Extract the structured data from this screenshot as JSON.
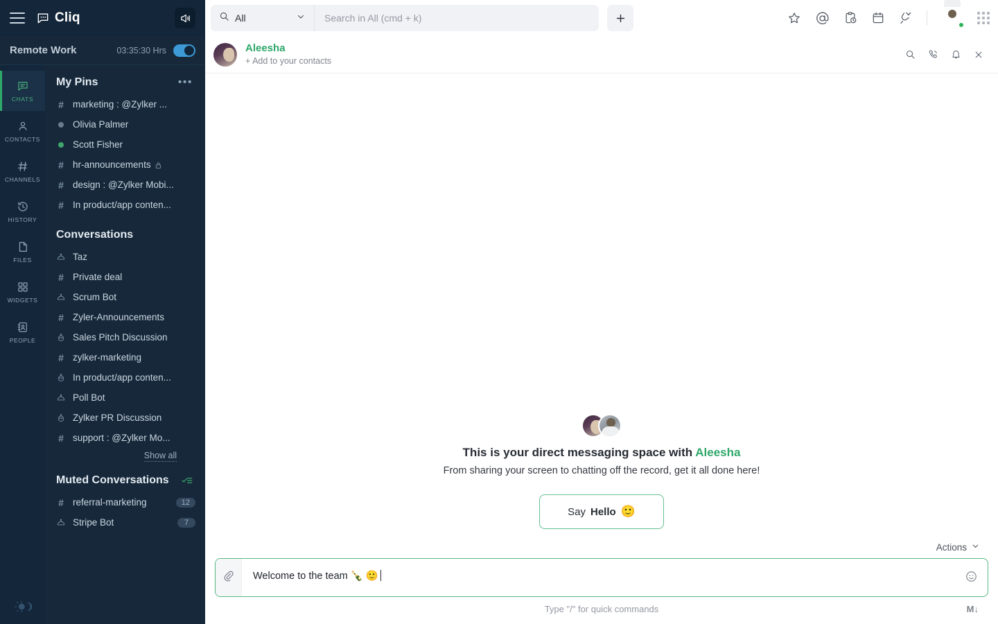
{
  "brand": {
    "name": "Cliq",
    "logo_icon": "chat-bubble-logo",
    "menu_icon": "hamburger-menu-icon",
    "announce_icon": "megaphone-icon"
  },
  "status": {
    "title": "Remote Work",
    "timer": "03:35:30 Hrs",
    "toggle_state": "on"
  },
  "rail": {
    "items": [
      {
        "label": "CHATS",
        "icon": "chat-icon",
        "active": true
      },
      {
        "label": "CONTACTS",
        "icon": "person-icon",
        "active": false
      },
      {
        "label": "CHANNELS",
        "icon": "hash-icon",
        "active": false
      },
      {
        "label": "HISTORY",
        "icon": "history-clock-icon",
        "active": false
      },
      {
        "label": "FILES",
        "icon": "file-icon",
        "active": false
      },
      {
        "label": "WIDGETS",
        "icon": "grid-squares-icon",
        "active": false
      },
      {
        "label": "PEOPLE",
        "icon": "contact-card-icon",
        "active": false
      }
    ],
    "theme_toggle_icon": "sun-theme-toggle-icon"
  },
  "pins": {
    "title": "My Pins",
    "more_icon": "more-dots-icon",
    "items": [
      {
        "label": "marketing : @Zylker ...",
        "icon": "hash",
        "locked": false
      },
      {
        "label": "Olivia Palmer",
        "icon": "status-offline",
        "locked": false
      },
      {
        "label": "Scott Fisher",
        "icon": "status-online",
        "locked": false
      },
      {
        "label": "hr-announcements",
        "icon": "hash",
        "locked": true
      },
      {
        "label": "design : @Zylker Mobi...",
        "icon": "hash",
        "locked": false
      },
      {
        "label": "In product/app conten...",
        "icon": "hash",
        "locked": false
      }
    ]
  },
  "conversations": {
    "title": "Conversations",
    "show_all": "Show all",
    "items": [
      {
        "label": "Taz",
        "icon": "bot"
      },
      {
        "label": "Private deal",
        "icon": "hash"
      },
      {
        "label": "Scrum Bot",
        "icon": "bot"
      },
      {
        "label": "Zyler-Announcements",
        "icon": "hash"
      },
      {
        "label": "Sales Pitch Discussion",
        "icon": "group"
      },
      {
        "label": "zylker-marketing",
        "icon": "hash"
      },
      {
        "label": "In product/app conten...",
        "icon": "group"
      },
      {
        "label": "Poll Bot",
        "icon": "bot"
      },
      {
        "label": "Zylker PR Discussion",
        "icon": "group"
      },
      {
        "label": "support : @Zylker Mo...",
        "icon": "hash"
      }
    ]
  },
  "muted": {
    "title": "Muted Conversations",
    "action_icon": "mark-read-checklist-icon",
    "items": [
      {
        "label": "referral-marketing",
        "icon": "hash",
        "badge": "12"
      },
      {
        "label": "Stripe Bot",
        "icon": "bot",
        "badge": "7"
      }
    ]
  },
  "topbar": {
    "scope_label": "All",
    "scope_icon": "search-icon",
    "scope_chevron": "chevron-down-icon",
    "search_placeholder": "Search in All (cmd + k)",
    "search_value": "",
    "new_button_icon": "plus-icon",
    "icons": [
      {
        "name": "star-icon"
      },
      {
        "name": "mention-at-icon"
      },
      {
        "name": "reminder-clipboard-clock-icon"
      },
      {
        "name": "calendar-icon"
      },
      {
        "name": "plug-integration-icon"
      }
    ],
    "avatar_name": "user-avatar",
    "presence": "online",
    "apps_grid_icon": "apps-grid-icon"
  },
  "chat_header": {
    "name": "Aleesha",
    "subtitle": "+ Add to your contacts",
    "avatar": "aleesha-avatar",
    "icons": [
      {
        "name": "search-icon"
      },
      {
        "name": "call-icon"
      },
      {
        "name": "bell-notification-icon"
      },
      {
        "name": "close-icon"
      }
    ]
  },
  "empty_state": {
    "title_prefix": "This is your direct messaging space with ",
    "title_name": "Aleesha",
    "subtitle": "From sharing your screen to chatting off the record, get it all done here!",
    "button_prefix": "Say ",
    "button_strong": "Hello",
    "button_emoji": "🙂"
  },
  "composer": {
    "actions_label": "Actions",
    "actions_chevron": "chevron-down-icon",
    "attach_icon": "paperclip-icon",
    "message_value": "Welcome to the team 🍾 🙂",
    "emoji_icon": "smiley-icon",
    "hint": "Type \"/\" for quick commands",
    "markdown_icon": "markdown-icon",
    "markdown_label": "M↓"
  },
  "colors": {
    "sidebar_bg": "#16283a",
    "rail_bg": "#14273a",
    "accent_green": "#2fa86a",
    "toggle_blue": "#3d9ad6",
    "badge_bg": "#34495e"
  }
}
